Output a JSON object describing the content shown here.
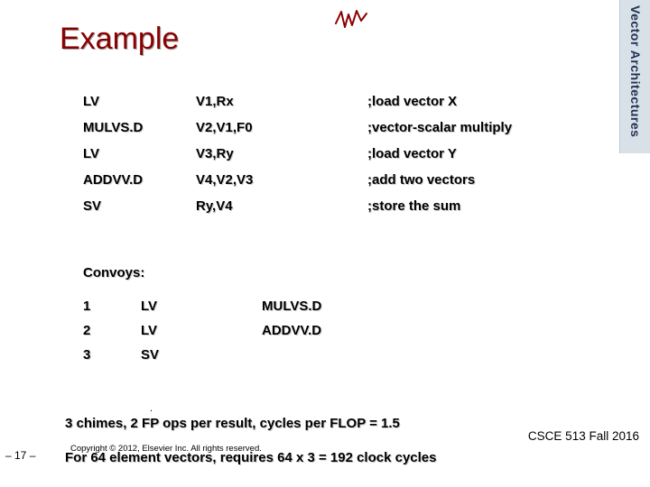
{
  "title": "Example",
  "sidebar_label": "Vector Architectures",
  "instructions": [
    {
      "op": "LV",
      "args": "V1,Rx",
      "comment": ";load vector X"
    },
    {
      "op": "MULVS.D",
      "args": "V2,V1,F0",
      "comment": ";vector-scalar multiply"
    },
    {
      "op": "LV",
      "args": "V3,Ry",
      "comment": ";load vector Y"
    },
    {
      "op": "ADDVV.D",
      "args": "V4,V2,V3",
      "comment": ";add two vectors"
    },
    {
      "op": "SV",
      "args": "Ry,V4",
      "comment": ";store the sum"
    }
  ],
  "convoys_label": "Convoys:",
  "convoys": [
    {
      "n": "1",
      "a": "LV",
      "b": "MULVS.D"
    },
    {
      "n": "2",
      "a": "LV",
      "b": "ADDVV.D"
    },
    {
      "n": "3",
      "a": "SV",
      "b": ""
    }
  ],
  "summary_line1": "3 chimes, 2 FP ops per result, cycles per FLOP = 1.5",
  "summary_line2": "For 64 element vectors, requires 64 x 3 = 192 clock cycles",
  "copyright": "Copyright © 2012, Elsevier Inc. All rights reserved.",
  "course": "CSCE 513 Fall 2016",
  "page_number": "– 17 –"
}
